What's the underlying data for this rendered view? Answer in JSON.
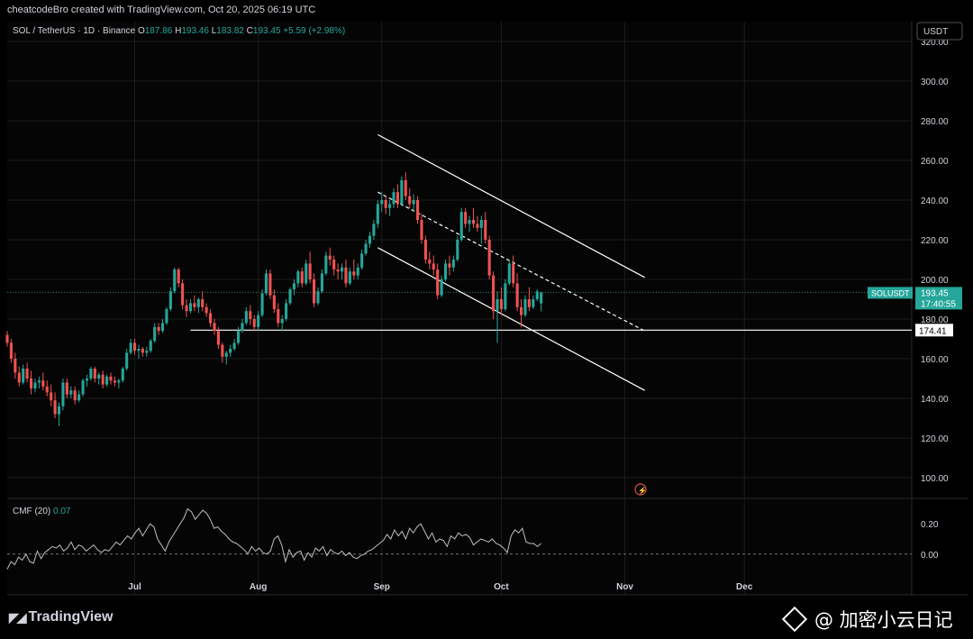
{
  "header": {
    "credit": "cheatcodeBro created with TradingView.com, Oct 20, 2025 06:19 UTC"
  },
  "legend": {
    "symbol": "SOL / TetherUS · 1D · Binance",
    "o_label": "O",
    "o_value": "187.86",
    "h_label": "H",
    "h_value": "193.46",
    "l_label": "L",
    "l_value": "183.82",
    "c_label": "C",
    "c_value": "193.45",
    "change": "+5.59 (+2.98%)"
  },
  "currency_badge": "USDT",
  "price_tag": {
    "symbol": "SOLUSDT",
    "price": "193.45",
    "countdown": "17:40:55"
  },
  "support_tag": "174.41",
  "indicator": {
    "name": "CMF (20)",
    "value": "0.07"
  },
  "footer": {
    "logo": "TradingView",
    "watermark": "@ 加密小云日记"
  },
  "colors": {
    "up": "#26a69a",
    "down": "#ef5350",
    "bg": "#000000",
    "grid": "#1c1c1c",
    "text": "#d1d4dc",
    "line": "#ffffff"
  },
  "chart_data": [
    {
      "type": "candlestick",
      "title": "SOL / TetherUS · 1D · Binance",
      "ylim": [
        90,
        330
      ],
      "y_ticks": [
        "320.00",
        "300.00",
        "280.00",
        "260.00",
        "240.00",
        "220.00",
        "200.00",
        "180.00",
        "160.00",
        "140.00",
        "120.00",
        "100.00"
      ],
      "y_tick_values": [
        320,
        300,
        280,
        260,
        240,
        220,
        200,
        180,
        160,
        140,
        120,
        100
      ],
      "x_ticks": [
        "Jul",
        "Aug",
        "Sep",
        "Oct",
        "Nov",
        "Dec"
      ],
      "x_tick_dates": [
        "2025-07-01",
        "2025-08-01",
        "2025-09-01",
        "2025-10-01",
        "2025-11-01",
        "2025-12-01"
      ],
      "x_range": [
        "2025-05-30",
        "2026-01-12"
      ],
      "last_price": 193.45,
      "support_level": 174.41,
      "support_start": "2025-07-15",
      "channel": {
        "upper": [
          [
            "2025-08-31",
            273
          ],
          [
            "2025-11-06",
            201
          ]
        ],
        "middle": [
          [
            "2025-08-31",
            244
          ],
          [
            "2025-11-06",
            174
          ]
        ],
        "lower": [
          [
            "2025-08-31",
            216
          ],
          [
            "2025-11-06",
            144
          ]
        ]
      },
      "candles": [
        [
          "2025-05-30",
          172,
          174,
          166,
          168
        ],
        [
          "2025-05-31",
          168,
          170,
          158,
          160
        ],
        [
          "2025-06-01",
          160,
          163,
          150,
          153
        ],
        [
          "2025-06-02",
          153,
          156,
          146,
          148
        ],
        [
          "2025-06-03",
          148,
          157,
          147,
          155
        ],
        [
          "2025-06-04",
          155,
          158,
          148,
          150
        ],
        [
          "2025-06-05",
          150,
          154,
          142,
          145
        ],
        [
          "2025-06-06",
          145,
          150,
          143,
          148
        ],
        [
          "2025-06-07",
          148,
          151,
          145,
          149
        ],
        [
          "2025-06-08",
          149,
          153,
          144,
          146
        ],
        [
          "2025-06-09",
          146,
          149,
          141,
          143
        ],
        [
          "2025-06-10",
          143,
          147,
          136,
          139
        ],
        [
          "2025-06-11",
          139,
          143,
          130,
          132
        ],
        [
          "2025-06-12",
          132,
          138,
          126,
          136
        ],
        [
          "2025-06-13",
          136,
          150,
          134,
          148
        ],
        [
          "2025-06-14",
          148,
          150,
          140,
          142
        ],
        [
          "2025-06-15",
          142,
          146,
          140,
          144
        ],
        [
          "2025-06-16",
          144,
          146,
          137,
          139
        ],
        [
          "2025-06-17",
          139,
          144,
          138,
          142
        ],
        [
          "2025-06-18",
          142,
          150,
          141,
          149
        ],
        [
          "2025-06-19",
          149,
          152,
          146,
          150
        ],
        [
          "2025-06-20",
          150,
          156,
          149,
          155
        ],
        [
          "2025-06-21",
          155,
          156,
          148,
          150
        ],
        [
          "2025-06-22",
          150,
          153,
          147,
          152
        ],
        [
          "2025-06-23",
          152,
          154,
          145,
          147
        ],
        [
          "2025-06-24",
          147,
          152,
          146,
          151
        ],
        [
          "2025-06-25",
          151,
          153,
          147,
          149
        ],
        [
          "2025-06-26",
          149,
          151,
          146,
          148
        ],
        [
          "2025-06-27",
          148,
          150,
          145,
          149
        ],
        [
          "2025-06-28",
          149,
          156,
          148,
          155
        ],
        [
          "2025-06-29",
          155,
          165,
          154,
          163
        ],
        [
          "2025-06-30",
          163,
          170,
          162,
          168
        ],
        [
          "2025-07-01",
          168,
          170,
          162,
          164
        ],
        [
          "2025-07-02",
          164,
          167,
          160,
          165
        ],
        [
          "2025-07-03",
          165,
          166,
          161,
          163
        ],
        [
          "2025-07-04",
          163,
          166,
          161,
          164
        ],
        [
          "2025-07-05",
          164,
          170,
          163,
          169
        ],
        [
          "2025-07-06",
          169,
          178,
          168,
          176
        ],
        [
          "2025-07-07",
          176,
          178,
          172,
          174
        ],
        [
          "2025-07-08",
          174,
          180,
          173,
          178
        ],
        [
          "2025-07-09",
          178,
          186,
          177,
          185
        ],
        [
          "2025-07-10",
          185,
          196,
          184,
          194
        ],
        [
          "2025-07-11",
          194,
          206,
          193,
          205
        ],
        [
          "2025-07-12",
          205,
          206,
          196,
          198
        ],
        [
          "2025-07-13",
          198,
          200,
          185,
          187
        ],
        [
          "2025-07-14",
          187,
          190,
          181,
          184
        ],
        [
          "2025-07-15",
          184,
          190,
          183,
          188
        ],
        [
          "2025-07-16",
          188,
          192,
          184,
          186
        ],
        [
          "2025-07-17",
          186,
          191,
          183,
          190
        ],
        [
          "2025-07-18",
          190,
          194,
          184,
          186
        ],
        [
          "2025-07-19",
          186,
          188,
          181,
          183
        ],
        [
          "2025-07-20",
          183,
          185,
          176,
          178
        ],
        [
          "2025-07-21",
          178,
          180,
          172,
          174
        ],
        [
          "2025-07-22",
          174,
          176,
          165,
          167
        ],
        [
          "2025-07-23",
          167,
          168,
          158,
          161
        ],
        [
          "2025-07-24",
          161,
          164,
          157,
          163
        ],
        [
          "2025-07-25",
          163,
          167,
          161,
          165
        ],
        [
          "2025-07-26",
          165,
          170,
          164,
          168
        ],
        [
          "2025-07-27",
          168,
          176,
          167,
          174
        ],
        [
          "2025-07-28",
          174,
          180,
          173,
          178
        ],
        [
          "2025-07-29",
          178,
          186,
          177,
          184
        ],
        [
          "2025-07-30",
          184,
          187,
          177,
          180
        ],
        [
          "2025-07-31",
          180,
          182,
          174,
          176
        ],
        [
          "2025-08-01",
          176,
          184,
          174,
          182
        ],
        [
          "2025-08-02",
          182,
          195,
          181,
          193
        ],
        [
          "2025-08-03",
          193,
          205,
          192,
          203
        ],
        [
          "2025-08-04",
          203,
          205,
          190,
          192
        ],
        [
          "2025-08-05",
          192,
          195,
          183,
          185
        ],
        [
          "2025-08-06",
          185,
          188,
          176,
          178
        ],
        [
          "2025-08-07",
          178,
          182,
          174,
          180
        ],
        [
          "2025-08-08",
          180,
          190,
          179,
          188
        ],
        [
          "2025-08-09",
          188,
          196,
          187,
          195
        ],
        [
          "2025-08-10",
          195,
          200,
          192,
          198
        ],
        [
          "2025-08-11",
          198,
          205,
          196,
          204
        ],
        [
          "2025-08-12",
          204,
          206,
          196,
          198
        ],
        [
          "2025-08-13",
          198,
          210,
          197,
          208
        ],
        [
          "2025-08-14",
          208,
          214,
          198,
          200
        ],
        [
          "2025-08-15",
          200,
          203,
          186,
          188
        ],
        [
          "2025-08-16",
          188,
          196,
          187,
          194
        ],
        [
          "2025-08-17",
          194,
          205,
          193,
          203
        ],
        [
          "2025-08-18",
          203,
          214,
          202,
          212
        ],
        [
          "2025-08-19",
          212,
          216,
          207,
          210
        ],
        [
          "2025-08-20",
          210,
          212,
          202,
          205
        ],
        [
          "2025-08-21",
          205,
          208,
          200,
          204
        ],
        [
          "2025-08-22",
          204,
          208,
          200,
          206
        ],
        [
          "2025-08-23",
          206,
          210,
          196,
          198
        ],
        [
          "2025-08-24",
          198,
          206,
          197,
          204
        ],
        [
          "2025-08-25",
          204,
          210,
          200,
          202
        ],
        [
          "2025-08-26",
          202,
          208,
          200,
          206
        ],
        [
          "2025-08-27",
          206,
          215,
          205,
          213
        ],
        [
          "2025-08-28",
          213,
          220,
          212,
          218
        ],
        [
          "2025-08-29",
          218,
          224,
          216,
          222
        ],
        [
          "2025-08-30",
          222,
          230,
          220,
          228
        ],
        [
          "2025-08-31",
          228,
          240,
          226,
          238
        ],
        [
          "2025-09-01",
          238,
          244,
          234,
          240
        ],
        [
          "2025-09-02",
          240,
          242,
          233,
          236
        ],
        [
          "2025-09-03",
          236,
          240,
          232,
          238
        ],
        [
          "2025-09-04",
          238,
          246,
          236,
          244
        ],
        [
          "2025-09-05",
          244,
          248,
          236,
          238
        ],
        [
          "2025-09-06",
          238,
          252,
          237,
          250
        ],
        [
          "2025-09-07",
          250,
          254,
          240,
          242
        ],
        [
          "2025-09-08",
          242,
          246,
          236,
          238
        ],
        [
          "2025-09-09",
          238,
          243,
          234,
          240
        ],
        [
          "2025-09-10",
          240,
          242,
          228,
          230
        ],
        [
          "2025-09-11",
          230,
          233,
          218,
          220
        ],
        [
          "2025-09-12",
          220,
          222,
          208,
          210
        ],
        [
          "2025-09-13",
          210,
          214,
          205,
          208
        ],
        [
          "2025-09-14",
          208,
          212,
          202,
          205
        ],
        [
          "2025-09-15",
          205,
          208,
          190,
          192
        ],
        [
          "2025-09-16",
          192,
          202,
          191,
          200
        ],
        [
          "2025-09-17",
          200,
          210,
          199,
          208
        ],
        [
          "2025-09-18",
          208,
          212,
          202,
          206
        ],
        [
          "2025-09-19",
          206,
          212,
          204,
          210
        ],
        [
          "2025-09-20",
          210,
          222,
          209,
          220
        ],
        [
          "2025-09-21",
          220,
          236,
          219,
          234
        ],
        [
          "2025-09-22",
          234,
          236,
          226,
          228
        ],
        [
          "2025-09-23",
          228,
          232,
          224,
          230
        ],
        [
          "2025-09-24",
          230,
          236,
          226,
          228
        ],
        [
          "2025-09-25",
          228,
          232,
          224,
          226
        ],
        [
          "2025-09-26",
          226,
          232,
          218,
          230
        ],
        [
          "2025-09-27",
          230,
          234,
          218,
          220
        ],
        [
          "2025-09-28",
          220,
          222,
          200,
          202
        ],
        [
          "2025-09-29",
          202,
          204,
          180,
          184
        ],
        [
          "2025-09-30",
          184,
          194,
          168,
          190
        ],
        [
          "2025-10-01",
          190,
          196,
          182,
          185
        ],
        [
          "2025-10-02",
          185,
          200,
          184,
          198
        ],
        [
          "2025-10-03",
          198,
          210,
          197,
          208
        ],
        [
          "2025-10-04",
          208,
          212,
          196,
          198
        ],
        [
          "2025-10-05",
          198,
          203,
          184,
          186
        ],
        [
          "2025-10-06",
          186,
          190,
          176,
          182
        ],
        [
          "2025-10-07",
          182,
          192,
          181,
          190
        ],
        [
          "2025-10-08",
          190,
          196,
          184,
          186
        ],
        [
          "2025-10-09",
          186,
          192,
          185,
          190
        ],
        [
          "2025-10-10",
          190,
          195,
          189,
          194
        ],
        [
          "2025-10-11",
          187.86,
          193.46,
          183.82,
          193.45
        ]
      ]
    },
    {
      "type": "line",
      "name": "CMF (20)",
      "ylim": [
        -0.15,
        0.35
      ],
      "y_ticks": [
        "0.20",
        "0.00"
      ],
      "y_tick_values": [
        0.2,
        0.0
      ],
      "zero_line": 0,
      "values": [
        -0.1,
        -0.05,
        -0.07,
        -0.02,
        -0.04,
        0.0,
        -0.05,
        -0.06,
        0.02,
        -0.03,
        0.01,
        0.03,
        0.05,
        0.04,
        0.06,
        0.02,
        0.04,
        0.08,
        0.03,
        0.06,
        0.05,
        0.02,
        0.04,
        0.06,
        0.03,
        0.01,
        0.03,
        0.02,
        0.05,
        0.08,
        0.06,
        0.09,
        0.12,
        0.1,
        0.14,
        0.17,
        0.12,
        0.16,
        0.2,
        0.18,
        0.1,
        0.06,
        0.02,
        0.08,
        0.12,
        0.16,
        0.2,
        0.24,
        0.3,
        0.28,
        0.23,
        0.26,
        0.29,
        0.27,
        0.23,
        0.17,
        0.18,
        0.15,
        0.13,
        0.1,
        0.08,
        0.07,
        0.05,
        0.03,
        0.0,
        0.05,
        0.02,
        0.04,
        0.01,
        0.0,
        0.02,
        0.1,
        0.12,
        0.06,
        -0.05,
        0.03,
        -0.02,
        0.01,
        0.02,
        -0.04,
        0.01,
        -0.02,
        0.04,
        0.02,
        0.05,
        -0.01,
        0.03,
        0.01,
        0.0,
        0.02,
        -0.01,
        0.01,
        -0.02,
        -0.03,
        -0.01,
        0.0,
        0.02,
        0.03,
        0.05,
        0.07,
        0.09,
        0.13,
        0.1,
        0.16,
        0.12,
        0.15,
        0.1,
        0.17,
        0.14,
        0.18,
        0.2,
        0.15,
        0.1,
        0.14,
        0.08,
        0.1,
        0.09,
        0.05,
        0.12,
        0.1,
        0.14,
        0.12,
        0.13,
        0.11,
        0.06,
        0.08,
        0.1,
        0.09,
        0.08,
        0.1,
        0.07,
        0.06,
        0.04,
        0.01,
        0.12,
        0.16,
        0.14,
        0.17,
        0.08,
        0.07,
        0.07,
        0.05,
        0.07
      ]
    }
  ]
}
